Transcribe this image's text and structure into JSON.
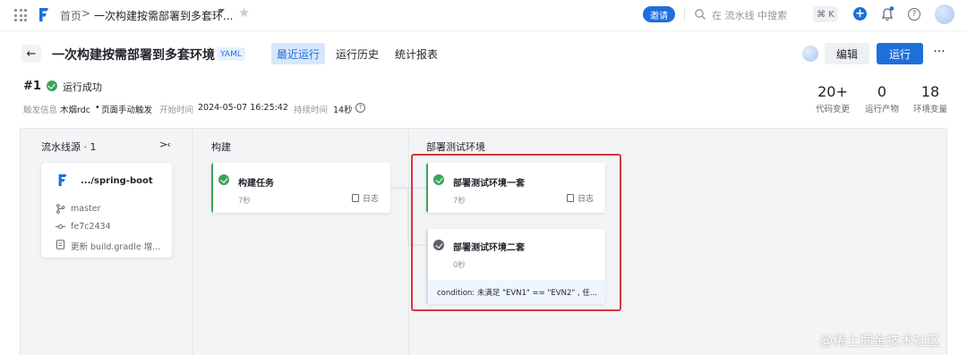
{
  "topbar": {
    "breadcrumb_home": "首页",
    "breadcrumb_sep": ">",
    "pipeline_title": "一次构建按需部署到多套环...",
    "invite_label": "邀请",
    "search_placeholder": "在 流水线 中搜索",
    "shortcut": "⌘ K",
    "plus": "+",
    "help": "?",
    "icons": [
      "apps-grid-icon",
      "flow-logo-icon",
      "chevron-down-icon",
      "star-icon",
      "search-icon",
      "plus-icon",
      "bell-icon",
      "help-icon"
    ]
  },
  "header": {
    "back": "←",
    "title": "一次构建按需部署到多套环境",
    "yaml_tag": "YAML",
    "tabs": [
      {
        "label": "最近运行",
        "active": true
      },
      {
        "label": "运行历史",
        "active": false
      },
      {
        "label": "统计报表",
        "active": false
      }
    ],
    "edit_label": "编辑",
    "run_label": "运行",
    "more": "···"
  },
  "run": {
    "number": "#1",
    "status": "运行成功",
    "trigger_label": "触发信息",
    "trigger_user": "木烟rdc",
    "trigger_sep": "•",
    "trigger_method": "页面手动触发",
    "start_label": "开始时间",
    "start_time": "2024-05-07 16:25:42",
    "duration_label": "持续时间",
    "duration": "14秒",
    "duration_help": "?",
    "stats": [
      {
        "value": "20+",
        "label": "代码变更"
      },
      {
        "value": "0",
        "label": "运行产物"
      },
      {
        "value": "18",
        "label": "环境变量"
      }
    ]
  },
  "stages": {
    "source": {
      "title": "流水线源 · 1",
      "collapse": ">‹",
      "repo": ".../spring-boot",
      "branch": "master",
      "commit": "fe7c2434",
      "message": "更新 build.gradle 增..."
    },
    "build": {
      "title": "构建",
      "jobs": [
        {
          "name": "构建任务",
          "duration": "7秒",
          "log": "日志",
          "status": "success"
        }
      ]
    },
    "deploy": {
      "title": "部署测试环境",
      "jobs": [
        {
          "name": "部署测试环境一套",
          "duration": "7秒",
          "log": "日志",
          "status": "success"
        },
        {
          "name": "部署测试环境二套",
          "duration": "0秒",
          "status": "skipped",
          "condition": "condition: 未满足 \"EVN1\" == \"EVN2\" , 任..."
        }
      ]
    }
  },
  "colors": {
    "accent": "#1e6fdc",
    "success": "#3aa55c",
    "skipped": "#5b6069",
    "highlight": "#d9363e"
  },
  "watermark": "@稀土掘金技术社区"
}
